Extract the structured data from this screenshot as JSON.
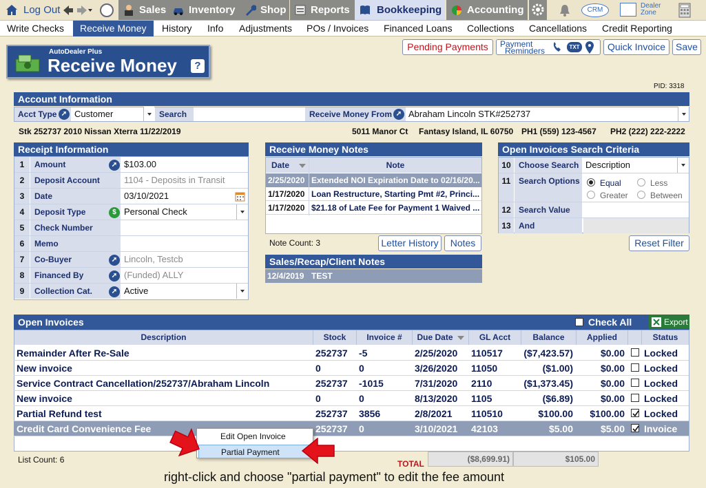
{
  "topnav": {
    "logout": "Log Out",
    "tabs": [
      "Sales",
      "Inventory",
      "Shop",
      "Reports",
      "Bookkeeping",
      "Accounting"
    ],
    "crm": "CRM",
    "dealer_zone_1": "Dealer",
    "dealer_zone_2": "Zone"
  },
  "subnav": [
    "Write Checks",
    "Receive Money",
    "History",
    "Info",
    "Adjustments",
    "POs / Invoices",
    "Financed Loans",
    "Collections",
    "Cancellations",
    "Credit Reporting"
  ],
  "title": {
    "brand": "AutoDealer Plus",
    "main": "Receive Money",
    "help": "?"
  },
  "buttons": {
    "pending": "Pending Payments",
    "payrem1": "Payment",
    "payrem2": "Reminders",
    "txt": "TXT",
    "quick": "Quick Invoice",
    "save": "Save",
    "letter": "Letter History",
    "notes": "Notes",
    "reset": "Reset Filter",
    "export": "Export"
  },
  "pid": "PID: 3318",
  "account": {
    "header": "Account Information",
    "acct_type_label": "Acct Type",
    "acct_type": "Customer",
    "search_label": "Search",
    "search_value": "",
    "from_label": "Receive Money From",
    "from_value": "Abraham Lincoln STK#252737",
    "stk": "Stk 252737 2010 Nissan Xterra 11/22/2019",
    "address": "5011 Manor Ct",
    "city": "Fantasy Island, IL 60750",
    "ph1": "PH1 (559) 123-4567",
    "ph2": "PH2 (222) 222-2222"
  },
  "receipt": {
    "header": "Receipt Information",
    "rows": [
      {
        "n": "1",
        "label": "Amount",
        "value": "$103.00"
      },
      {
        "n": "2",
        "label": "Deposit Account",
        "value": "1104 - Deposits in Transit"
      },
      {
        "n": "3",
        "label": "Date",
        "value": "03/10/2021"
      },
      {
        "n": "4",
        "label": "Deposit Type",
        "value": "Personal Check"
      },
      {
        "n": "5",
        "label": "Check Number",
        "value": ""
      },
      {
        "n": "6",
        "label": "Memo",
        "value": ""
      },
      {
        "n": "7",
        "label": "Co-Buyer",
        "value": "Lincoln, Testcb"
      },
      {
        "n": "8",
        "label": "Financed By",
        "value": "(Funded) ALLY"
      },
      {
        "n": "9",
        "label": "Collection Cat.",
        "value": "Active"
      }
    ]
  },
  "notes": {
    "header": "Receive Money Notes",
    "col_date": "Date",
    "col_note": "Note",
    "rows": [
      {
        "date": "2/25/2020",
        "note": "Extended NOI Expiration Date to 02/16/20..."
      },
      {
        "date": "1/17/2020",
        "note": "Loan Restructure, Starting Pmt #2, Princi..."
      },
      {
        "date": "1/17/2020",
        "note": "$21.18 of Late Fee for Payment 1 Waived ..."
      }
    ],
    "count_label": "Note Count:",
    "count": "3"
  },
  "recap": {
    "header": "Sales/Recap/Client Notes",
    "date": "12/4/2019",
    "note": "TEST"
  },
  "criteria": {
    "header": "Open Invoices Search Criteria",
    "r10_label": "Choose Search",
    "r10_value": "Description",
    "r11_label": "Search Options",
    "opt_equal": "Equal",
    "opt_less": "Less",
    "opt_greater": "Greater",
    "opt_between": "Between",
    "r12_label": "Search Value",
    "r13_label": "And"
  },
  "invoices": {
    "header": "Open Invoices",
    "check_all": "Check All",
    "columns": [
      "Description",
      "Stock",
      "Invoice #",
      "Due Date",
      "GL Acct",
      "Balance",
      "Applied",
      "",
      "Status"
    ],
    "rows": [
      {
        "desc": "Remainder After Re-Sale",
        "stock": "252737",
        "inv": "-5",
        "due": "2/25/2020",
        "gl": "110517",
        "bal": "($7,423.57)",
        "app": "$0.00",
        "checked": false,
        "status": "Locked"
      },
      {
        "desc": "New invoice",
        "stock": "0",
        "inv": "0",
        "due": "3/26/2020",
        "gl": "11050",
        "bal": "($1.00)",
        "app": "$0.00",
        "checked": false,
        "status": "Locked"
      },
      {
        "desc": "Service Contract Cancellation/252737/Abraham Lincoln",
        "stock": "252737",
        "inv": "-1015",
        "due": "7/31/2020",
        "gl": "2110",
        "bal": "($1,373.45)",
        "app": "$0.00",
        "checked": false,
        "status": "Locked"
      },
      {
        "desc": "New invoice",
        "stock": "0",
        "inv": "0",
        "due": "8/13/2020",
        "gl": "1105",
        "bal": "($6.89)",
        "app": "$0.00",
        "checked": false,
        "status": "Locked"
      },
      {
        "desc": "Partial Refund test",
        "stock": "252737",
        "inv": "3856",
        "due": "2/8/2021",
        "gl": "110510",
        "bal": "$100.00",
        "app": "$100.00",
        "checked": true,
        "status": "Locked"
      },
      {
        "desc": "Credit Card Convenience Fee",
        "stock": "252737",
        "inv": "0",
        "due": "3/10/2021",
        "gl": "42103",
        "bal": "$5.00",
        "app": "$5.00",
        "checked": true,
        "status": "Invoice"
      }
    ],
    "list_count_label": "List Count:",
    "list_count": "6",
    "total_label": "TOTAL",
    "total_balance": "($8,699.91)",
    "total_applied": "$105.00"
  },
  "context_menu": [
    "Edit Open Invoice",
    "Partial Payment"
  ],
  "caption": "right-click and choose \"partial payment\" to edit the fee amount",
  "colors": {
    "nav_blue": "#33589a",
    "bg": "#f2ecd4",
    "highlight": "#8f9cb5",
    "arrow_red": "#e3121b"
  }
}
